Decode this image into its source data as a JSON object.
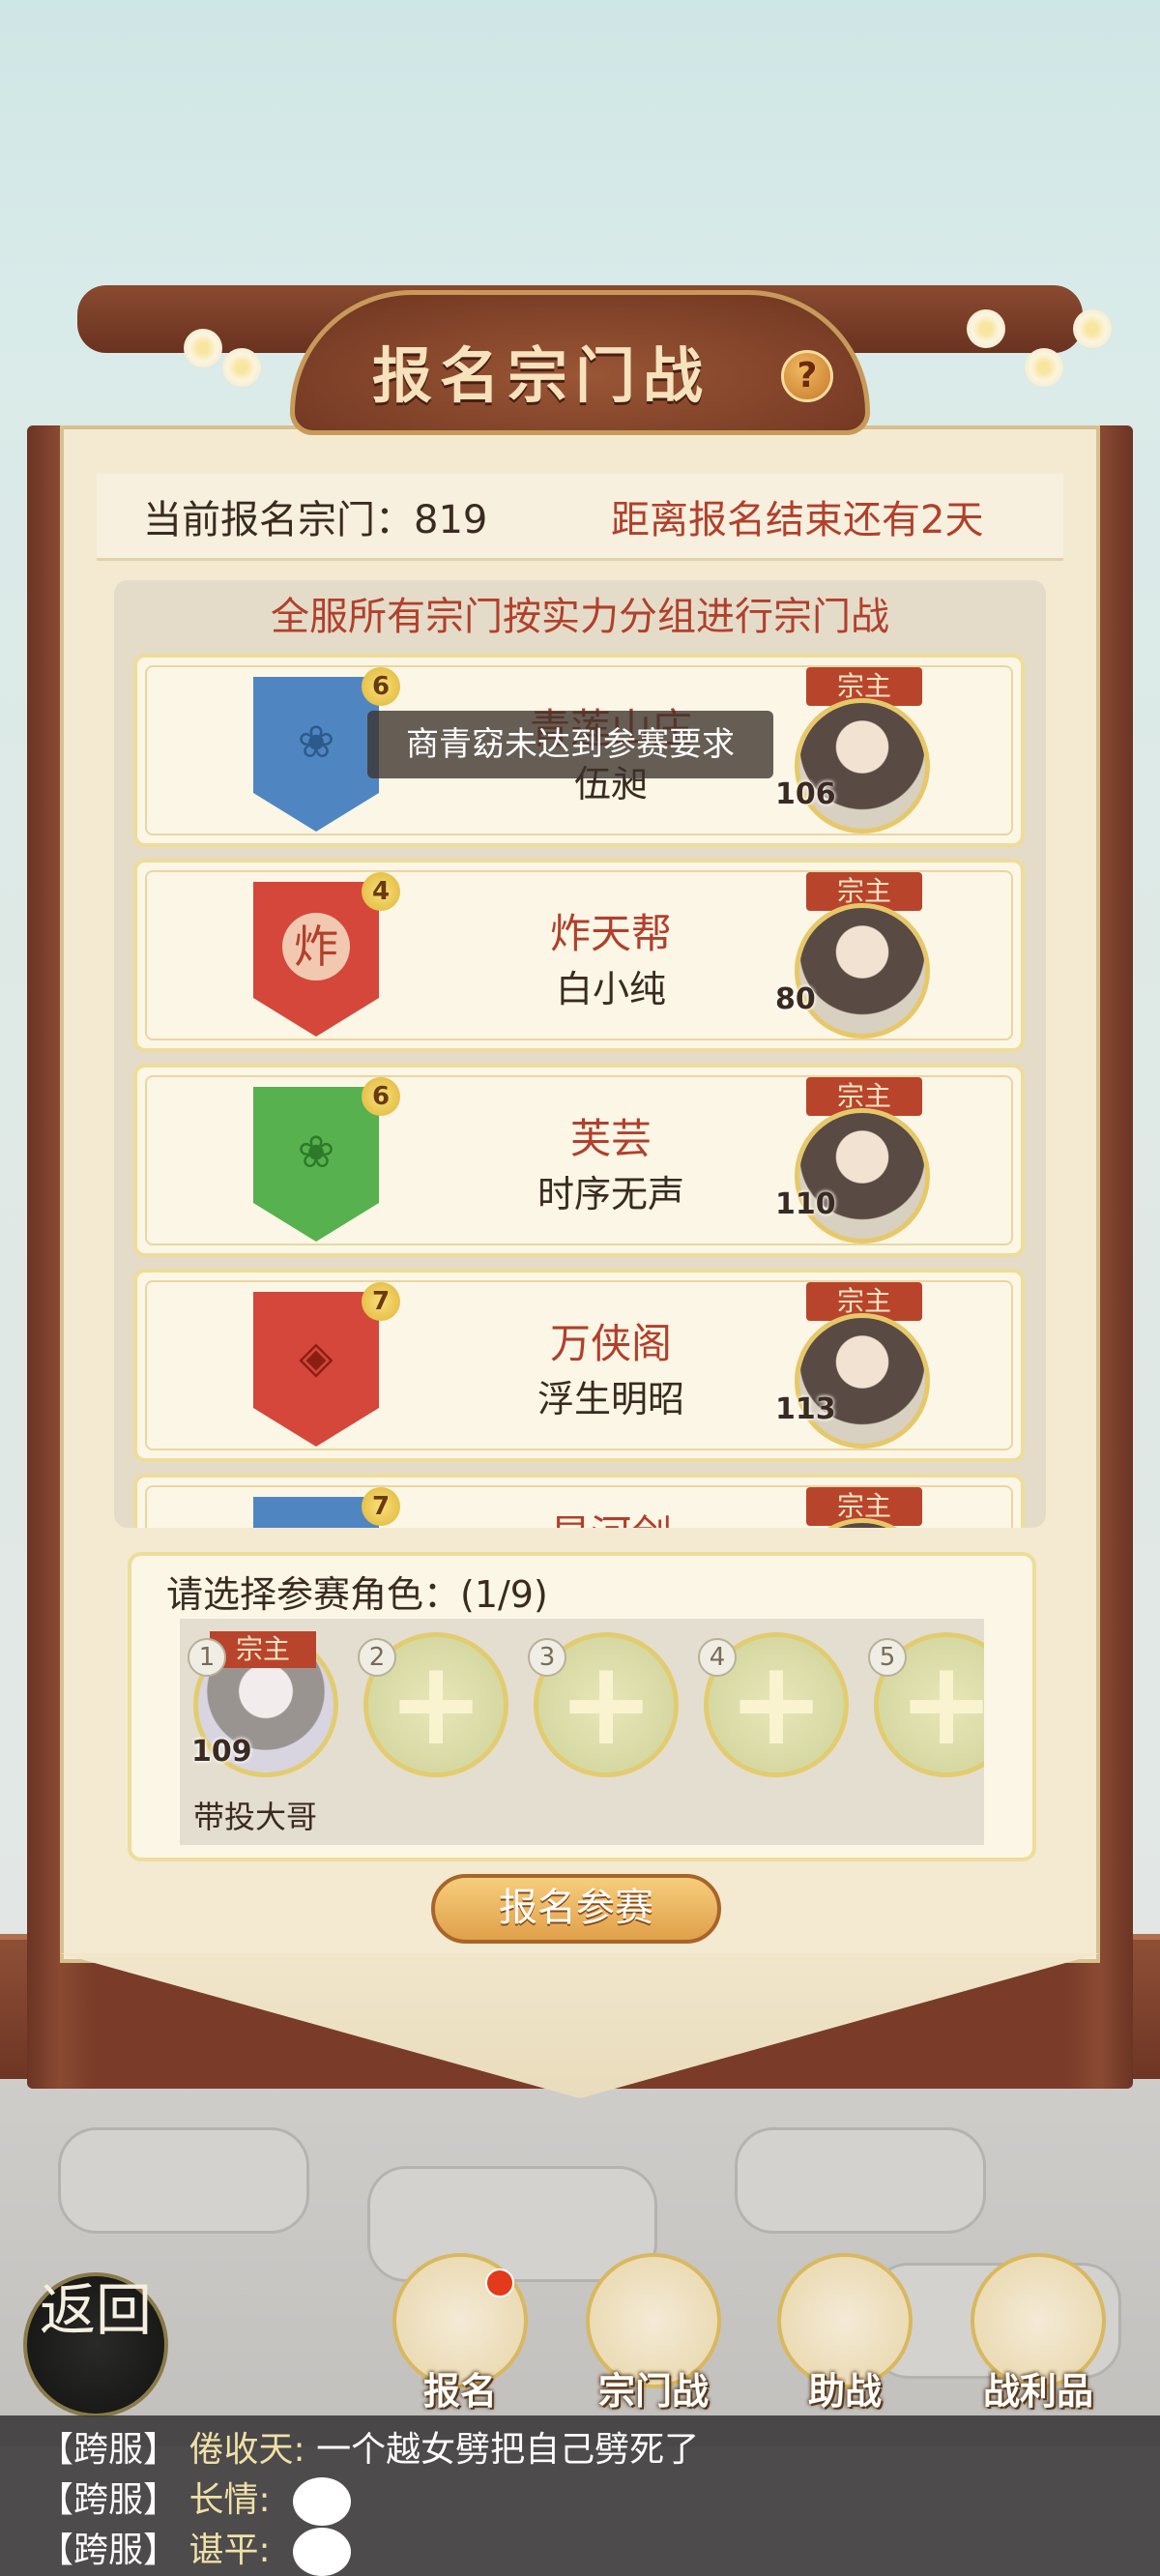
{
  "title": "报名宗门战",
  "help_glyph": "?",
  "info": {
    "count_label": "当前报名宗门：819",
    "deadline": "距离报名结束还有2天"
  },
  "list_header": "全服所有宗门按实力分组进行宗门战",
  "toast": "商青窈未达到参赛要求",
  "leader_tag": "宗主",
  "sects": [
    {
      "level": "6",
      "name": "青莲山庄",
      "leader": "伍昶",
      "power": "106",
      "color": "#4f86c2",
      "emblem": "❀"
    },
    {
      "level": "4",
      "name": "炸天帮",
      "leader": "白小纯",
      "power": "80",
      "color": "#d4473a",
      "emblem": "炸"
    },
    {
      "level": "6",
      "name": "芙芸",
      "leader": "时序无声",
      "power": "110",
      "color": "#57b14e",
      "emblem": "❀"
    },
    {
      "level": "7",
      "name": "万侠阁",
      "leader": "浮生明昭",
      "power": "113",
      "color": "#d4473a",
      "emblem": "◈"
    },
    {
      "level": "7",
      "name": "星河剑",
      "leader": "",
      "power": "",
      "color": "#4f86c2",
      "emblem": ""
    }
  ],
  "role_select": {
    "title": "请选择参赛角色：(1/9)",
    "slots": [
      {
        "num": "1",
        "name": "带投大哥",
        "power": "109",
        "tag": "宗主"
      },
      {
        "num": "2"
      },
      {
        "num": "3"
      },
      {
        "num": "4"
      },
      {
        "num": "5"
      }
    ]
  },
  "signup_button": "报名参赛",
  "back_button": "返回",
  "nav": [
    {
      "label": "报名",
      "icon": "scroll-icon",
      "badge": true
    },
    {
      "label": "宗门战",
      "icon": "mountain-flag-icon",
      "badge": false
    },
    {
      "label": "助战",
      "icon": "handshake-icon",
      "badge": false
    },
    {
      "label": "战利品",
      "icon": "treasure-chest-icon",
      "badge": false
    }
  ],
  "chat": [
    {
      "tag": "【跨服】",
      "user": "倦收天:",
      "text": "一个越女劈把自己劈死了"
    },
    {
      "tag": "【跨服】",
      "user": "长情:",
      "text": ""
    },
    {
      "tag": "【跨服】",
      "user": "谌平:",
      "text": ""
    }
  ],
  "colors": {
    "accent_red": "#b1402c",
    "wood": "#7a3c28",
    "parchment": "#f4ead2"
  }
}
